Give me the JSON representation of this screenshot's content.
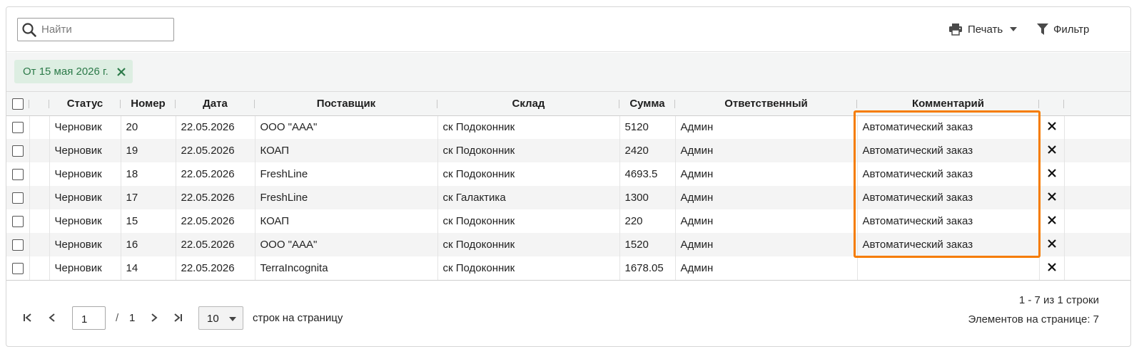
{
  "toolbar": {
    "search_placeholder": "Найти",
    "print_label": "Печать",
    "filter_label": "Фильтр"
  },
  "chips": [
    {
      "label": "От 15 мая 2026 г."
    }
  ],
  "table": {
    "headers": {
      "status": "Статус",
      "number": "Номер",
      "date": "Дата",
      "supplier": "Поставщик",
      "warehouse": "Склад",
      "sum": "Сумма",
      "responsible": "Ответственный",
      "comment": "Комментарий"
    },
    "rows": [
      {
        "status": "Черновик",
        "number": "20",
        "date": "22.05.2026",
        "supplier": "ООО \"ААА\"",
        "warehouse": "ск Подоконник",
        "sum": "5120",
        "responsible": "Админ",
        "comment": "Автоматический заказ"
      },
      {
        "status": "Черновик",
        "number": "19",
        "date": "22.05.2026",
        "supplier": "КОАП",
        "warehouse": "ск Подоконник",
        "sum": "2420",
        "responsible": "Админ",
        "comment": "Автоматический заказ"
      },
      {
        "status": "Черновик",
        "number": "18",
        "date": "22.05.2026",
        "supplier": "FreshLine",
        "warehouse": "ск Подоконник",
        "sum": "4693.5",
        "responsible": "Админ",
        "comment": "Автоматический заказ"
      },
      {
        "status": "Черновик",
        "number": "17",
        "date": "22.05.2026",
        "supplier": "FreshLine",
        "warehouse": "ск Галактика",
        "sum": "1300",
        "responsible": "Админ",
        "comment": "Автоматический заказ"
      },
      {
        "status": "Черновик",
        "number": "15",
        "date": "22.05.2026",
        "supplier": "КОАП",
        "warehouse": "ск Подоконник",
        "sum": "220",
        "responsible": "Админ",
        "comment": "Автоматический заказ"
      },
      {
        "status": "Черновик",
        "number": "16",
        "date": "22.05.2026",
        "supplier": "ООО \"ААА\"",
        "warehouse": "ск Подоконник",
        "sum": "1520",
        "responsible": "Админ",
        "comment": "Автоматический заказ"
      },
      {
        "status": "Черновик",
        "number": "14",
        "date": "22.05.2026",
        "supplier": "TerraIncognita",
        "warehouse": "ск Подоконник",
        "sum": "1678.05",
        "responsible": "Админ",
        "comment": ""
      }
    ]
  },
  "pager": {
    "current_page": "1",
    "slash": "/",
    "total_pages": "1",
    "page_size": "10",
    "rows_per_page_label": "строк на страницу",
    "range_text": "1 - 7 из 1 строки",
    "items_per_page_text": "Элементов на странице: 7"
  },
  "colors": {
    "accent_highlight": "#f57c00",
    "chip_bg": "#ddeee2",
    "chip_text": "#2c7a49"
  }
}
